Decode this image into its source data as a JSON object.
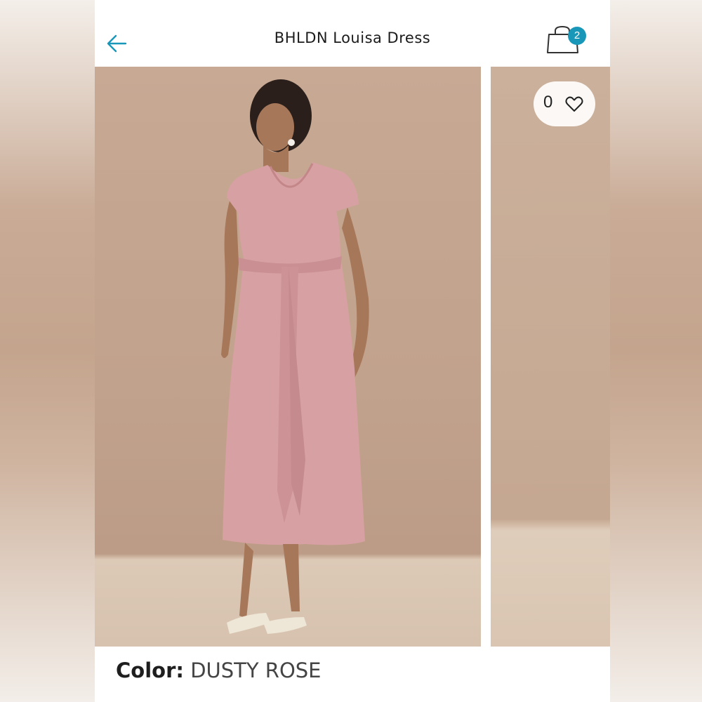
{
  "header": {
    "title": "BHLDN Louisa Dress",
    "back_icon": "back-arrow-icon",
    "cart_icon": "shopping-bag-icon",
    "cart_count": "2",
    "accent_color": "#1897b9"
  },
  "gallery": {
    "like_count": "0",
    "like_icon": "heart-icon"
  },
  "product": {
    "color_label": "Color:",
    "color_value": "DUSTY ROSE"
  }
}
